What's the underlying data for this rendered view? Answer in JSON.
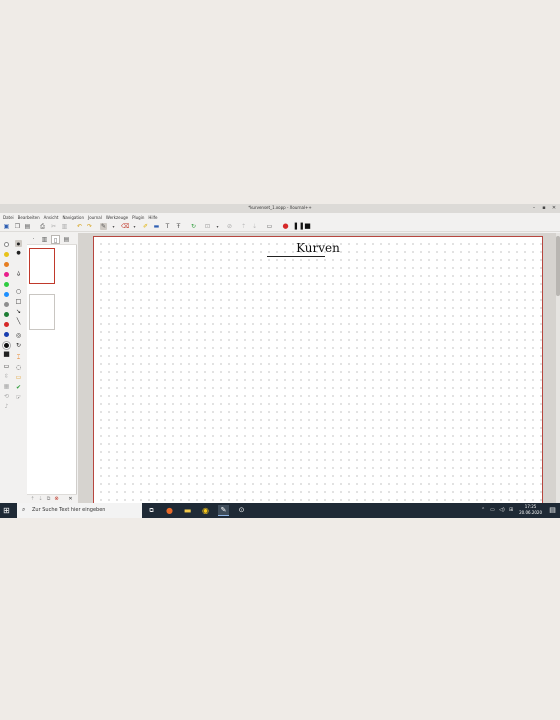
{
  "window": {
    "title": "*kurvenset_1.xopp - Xournal++",
    "minimize": "–",
    "maximize": "▪",
    "close": "✕"
  },
  "menu": [
    "Datei",
    "Bearbeiten",
    "Ansicht",
    "Navigation",
    "Journal",
    "Werkzeuge",
    "Plugin",
    "Hilfe"
  ],
  "page": {
    "heading": "Kurven"
  },
  "taskbar": {
    "search_placeholder": "Zur Suche Text hier eingeben",
    "time": "17:25",
    "date": "20.06.2020"
  },
  "colors": {
    "palette": [
      "#ffffff",
      "#e8c21a",
      "#e67e22",
      "#e91e8c",
      "#2ecc40",
      "#1e90ff",
      "#8e8e8e",
      "#1e7e34",
      "#d62828",
      "#1a3fb0",
      "#111111",
      "#111111"
    ],
    "accent_page_border": "#b7463f",
    "toolbar_red": "#d62828"
  }
}
